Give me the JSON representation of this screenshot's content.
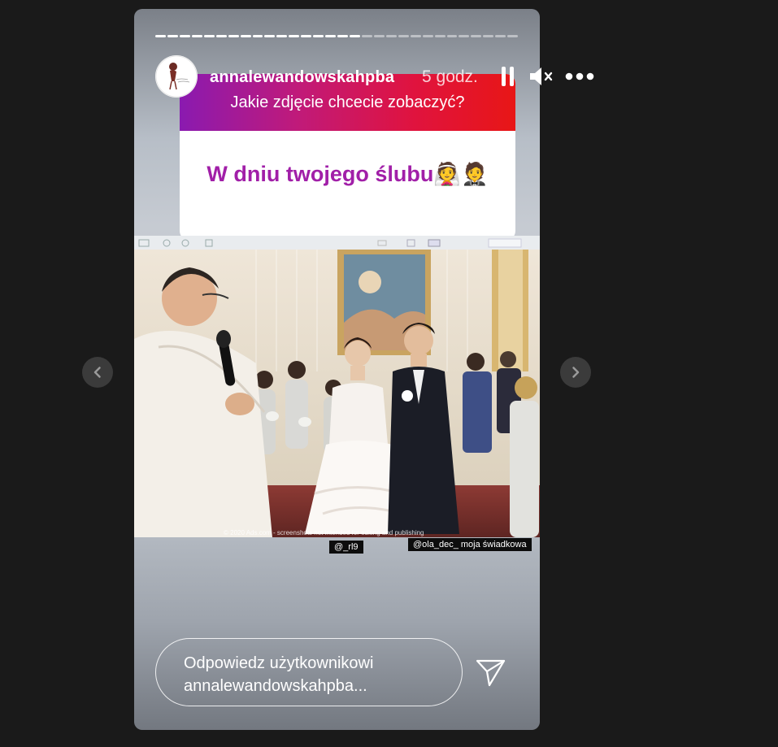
{
  "story": {
    "username": "annalewandowskahpba",
    "timestamp": "5 godz.",
    "progress_segments_total": 30,
    "progress_segments_done": 17
  },
  "controls": {
    "pause_icon": "pause-icon",
    "mute_icon": "speaker-muted-icon",
    "more_icon": "more-options-icon"
  },
  "question": {
    "prompt": "Jakie zdjęcie chcecie zobaczyć?",
    "answer": "W dniu twojego ślubu👰🤵"
  },
  "photo": {
    "watermark": "© 2020 Ads.com - screenshots not intended for editing and publishing",
    "tag_1": "@_rl9",
    "tag_2": "@ola_dec_ moja świadkowa"
  },
  "reply": {
    "placeholder": "Odpowiedz użytkownikowi annalewandowskahpba..."
  },
  "colors": {
    "background": "#1a1a1a",
    "answer_text": "#a11fa8",
    "question_gradient_start": "#8a1ab0",
    "question_gradient_end": "#e81616"
  }
}
